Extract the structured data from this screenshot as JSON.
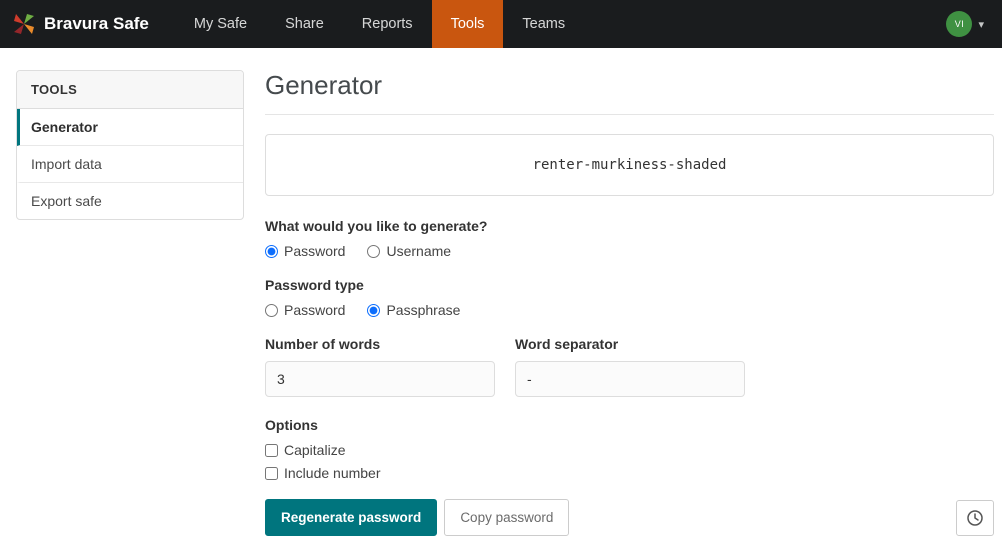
{
  "nav": {
    "brand": "Bravura Safe",
    "items": [
      {
        "label": "My Safe",
        "active": false
      },
      {
        "label": "Share",
        "active": false
      },
      {
        "label": "Reports",
        "active": false
      },
      {
        "label": "Tools",
        "active": true
      },
      {
        "label": "Teams",
        "active": false
      }
    ],
    "avatar_initials": "VI",
    "caret": "▾"
  },
  "sidebar": {
    "title": "TOOLS",
    "items": [
      {
        "label": "Generator",
        "active": true
      },
      {
        "label": "Import data",
        "active": false
      },
      {
        "label": "Export safe",
        "active": false
      }
    ]
  },
  "generator": {
    "title": "Generator",
    "generated_value": "renter-murkiness-shaded",
    "generate_question": "What would you like to generate?",
    "generate_options": [
      {
        "label": "Password",
        "selected": true
      },
      {
        "label": "Username",
        "selected": false
      }
    ],
    "password_type_label": "Password type",
    "password_type_options": [
      {
        "label": "Password",
        "selected": false
      },
      {
        "label": "Passphrase",
        "selected": true
      }
    ],
    "num_words_label": "Number of words",
    "num_words_value": "3",
    "separator_label": "Word separator",
    "separator_value": "-",
    "options_label": "Options",
    "options": [
      {
        "label": "Capitalize",
        "checked": false
      },
      {
        "label": "Include number",
        "checked": false
      }
    ],
    "regenerate_button": "Regenerate password",
    "copy_button": "Copy password"
  },
  "icons": {
    "logo": "bravura-pinwheel",
    "history": "clock",
    "caret": "chevron-down"
  },
  "colors": {
    "nav_bg": "#1a1c1e",
    "active_tab_orange": "#c9560f",
    "teal_accent": "#00757e",
    "radio_blue": "#0d6efd",
    "avatar_green": "#3f9142"
  }
}
